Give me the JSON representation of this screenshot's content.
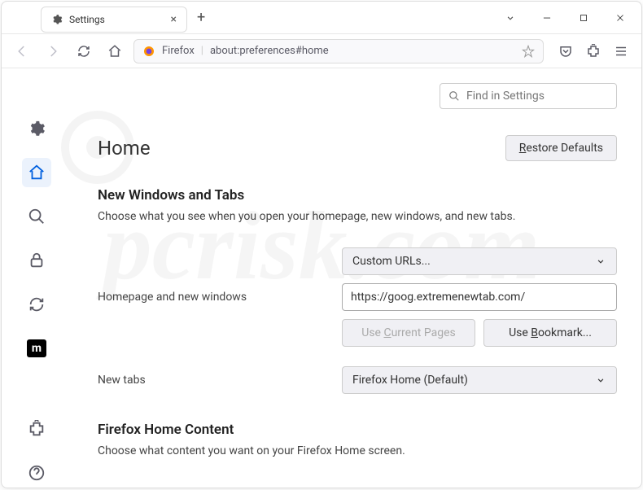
{
  "window": {
    "tab_title": "Settings"
  },
  "toolbar": {
    "url_prefix": "Firefox",
    "url_text": "about:preferences#home"
  },
  "search": {
    "placeholder": "Find in Settings"
  },
  "page": {
    "heading": "Home",
    "restore_button": "Restore Defaults"
  },
  "section1": {
    "title": "New Windows and Tabs",
    "description": "Choose what you see when you open your homepage, new windows, and new tabs.",
    "homepage_label": "Homepage and new windows",
    "homepage_dropdown": "Custom URLs...",
    "homepage_url": "https://goog.extremenewtab.com/",
    "use_current_pages": "Use Current Pages",
    "use_bookmark": "Use Bookmark...",
    "new_tabs_label": "New tabs",
    "new_tabs_dropdown": "Firefox Home (Default)"
  },
  "section2": {
    "title": "Firefox Home Content",
    "description": "Choose what content you want on your Firefox Home screen."
  },
  "watermark": "pcrisk.com"
}
